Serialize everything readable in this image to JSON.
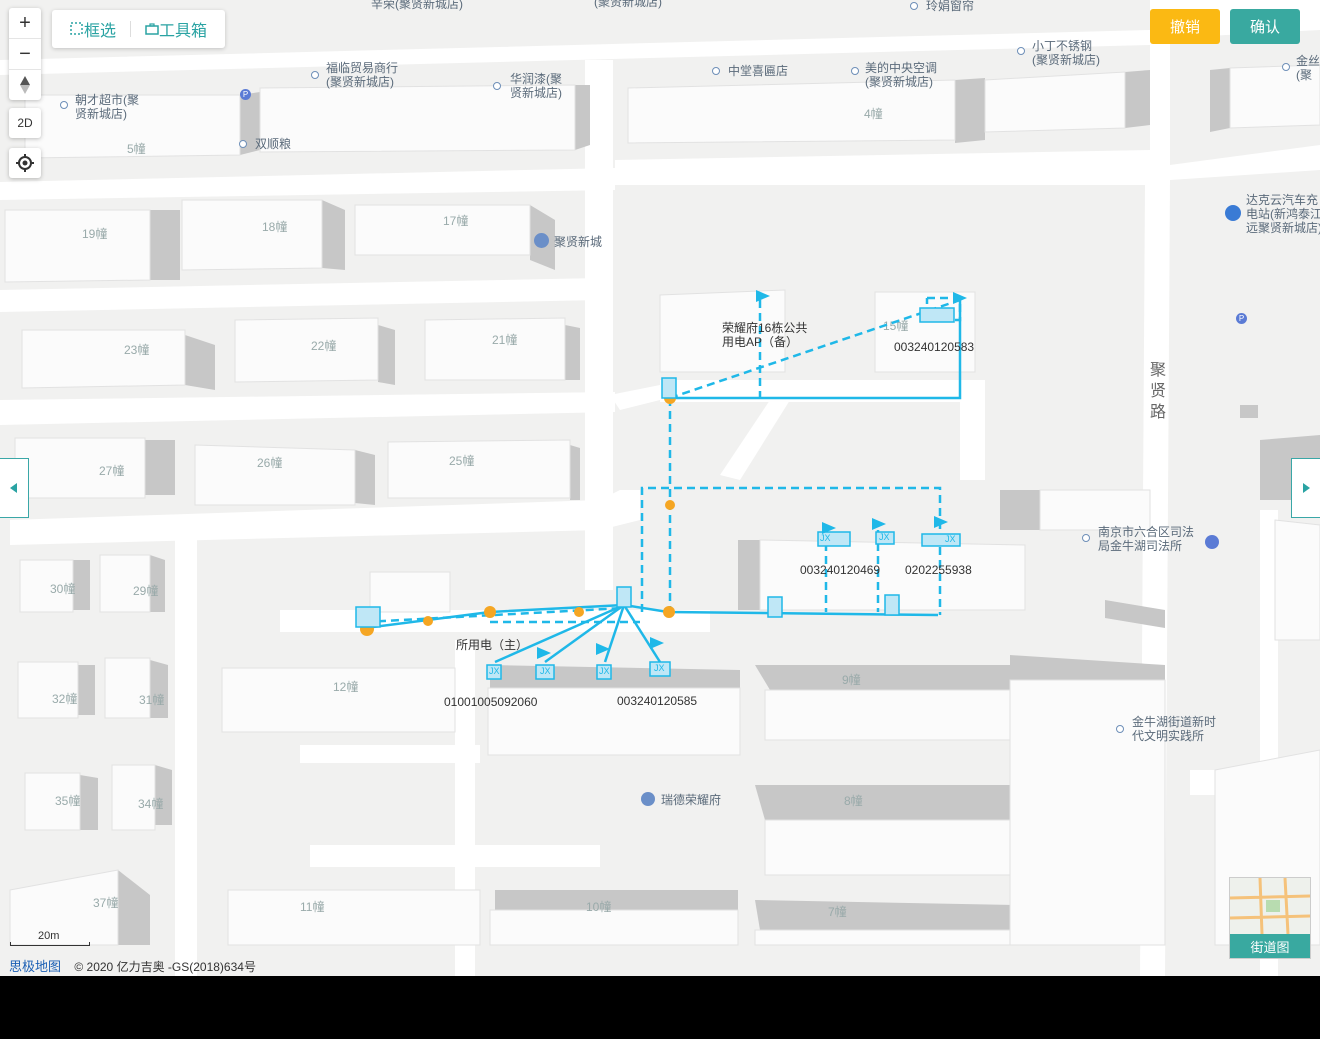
{
  "toolbar": {
    "select_label": "框选",
    "toolbox_label": "工具箱"
  },
  "actions": {
    "cancel_label": "撤销",
    "confirm_label": "确认",
    "cancel_color": "#fbb913",
    "confirm_color": "#39a9a0"
  },
  "map_controls": {
    "zoom_in": "+",
    "zoom_out": "−",
    "mode_2d": "2D"
  },
  "scale_label": "20m",
  "footer": {
    "brand": "思极地图",
    "copyright": "© 2020 亿力吉奥 -GS(2018)634号"
  },
  "street_view_label": "街道图",
  "colors": {
    "network": "#1fb8e8",
    "node": "#f5a623",
    "building_top": "#fafafa",
    "building_side": "#c9c9c9",
    "road": "#ffffff"
  },
  "pois": {
    "p1": "辛荣(聚贤新城店)",
    "p2": "(聚贤新城店)",
    "p3": "玲娟窗帘",
    "p4": "福临贸易商行\n(聚贤新城店)",
    "p5": "华润漆(聚\n贤新城店)",
    "p6": "中堂喜匾店",
    "p7": "美的中央空调\n(聚贤新城店)",
    "p8": "小丁不锈钢\n(聚贤新城店)",
    "p9": "金丝\n(聚",
    "p10": "朝才超市(聚\n贤新城店)",
    "p11": "双顺粮",
    "p12": "聚贤新城",
    "p13": "达克云汽车充\n电站(新鸿泰江\n远聚贤新城店)",
    "p14": "南京市六合区司法\n局金牛湖司法所",
    "p15": "金牛湖街道新时\n代文明实践所",
    "p16": "瑞德荣耀府"
  },
  "road_label": "聚\n贤\n路",
  "buildings": [
    "5幢",
    "4幢",
    "19幢",
    "18幢",
    "17幢",
    "15幢",
    "23幢",
    "22幢",
    "21幢",
    "27幢",
    "26幢",
    "25幢",
    "30幢",
    "29幢",
    "32幢",
    "31幢",
    "12幢",
    "9幢",
    "35幢",
    "34幢",
    "8幢",
    "37幢",
    "11幢",
    "10幢",
    "7幢"
  ],
  "network": {
    "ap_label": "荣耀府16栋公共\n用电AP（备）",
    "main_label": "所用电（主）",
    "ids": [
      "003240120583",
      "003240120469",
      "0202255938",
      "01001005092060",
      "003240120585"
    ],
    "box_labels": [
      "JX",
      "JX",
      "JX",
      "JX",
      "JX",
      "JX",
      "JX"
    ]
  }
}
